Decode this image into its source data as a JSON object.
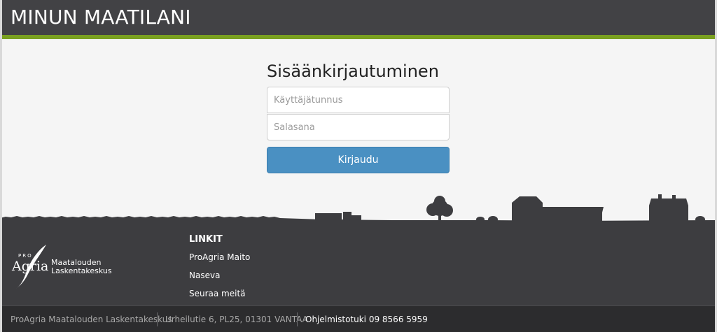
{
  "header": {
    "title": "MINUN MAATILANI"
  },
  "login": {
    "title": "Sisäänkirjautuminen",
    "username_placeholder": "Käyttäjätunnus",
    "password_placeholder": "Salasana",
    "submit_label": "Kirjaudu"
  },
  "footer": {
    "logo": {
      "pro": "PRO",
      "agria": "Agria",
      "org_line1": "Maatalouden",
      "org_line2": "Laskentakeskus"
    },
    "links_title": "LINKIT",
    "links": [
      "ProAgria Maito",
      "Naseva",
      "Seuraa meitä"
    ],
    "bottom": {
      "company": "ProAgria Maatalouden Laskentakeskus",
      "address": "Urheilutie 6, PL25, 01301 VANTAA",
      "support": "Ohjelmistotuki 09 8566 5959"
    }
  },
  "colors": {
    "header_bg": "#424245",
    "accent_green": "#7aa021",
    "button_blue": "#4a90c2",
    "footer_bg": "#3d3d40",
    "bottom_bar_bg": "#2c2c2e"
  }
}
